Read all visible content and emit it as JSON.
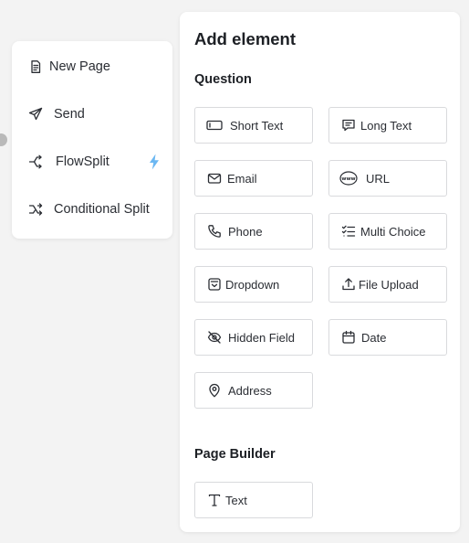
{
  "menu": {
    "items": [
      {
        "label": "New Page",
        "icon": "document-icon"
      },
      {
        "label": "Send",
        "icon": "send-icon"
      },
      {
        "label": "FlowSplit",
        "icon": "split-icon",
        "badge": "lightning-icon"
      },
      {
        "label": "Conditional Split",
        "icon": "conditional-split-icon"
      }
    ]
  },
  "panel": {
    "title": "Add element",
    "question_heading": "Question",
    "question_items": [
      {
        "label": "Short Text",
        "icon": "short-text-icon"
      },
      {
        "label": "Long Text",
        "icon": "long-text-icon"
      },
      {
        "label": "Email",
        "icon": "email-icon"
      },
      {
        "label": "URL",
        "icon": "www-icon"
      },
      {
        "label": "Phone",
        "icon": "phone-icon"
      },
      {
        "label": "Multi Choice",
        "icon": "checklist-icon"
      },
      {
        "label": "Dropdown",
        "icon": "dropdown-icon"
      },
      {
        "label": "File Upload",
        "icon": "upload-icon"
      },
      {
        "label": "Hidden Field",
        "icon": "eye-off-icon"
      },
      {
        "label": "Date",
        "icon": "calendar-icon"
      },
      {
        "label": "Address",
        "icon": "map-pin-icon"
      }
    ],
    "page_builder_heading": "Page Builder",
    "page_builder_items": [
      {
        "label": "Text",
        "icon": "text-type-icon"
      }
    ]
  },
  "colors": {
    "background": "#f3f3f3",
    "card": "#ffffff",
    "border": "#d9dadd",
    "text": "#2a2d33",
    "lightning": "#6bb7f2"
  }
}
